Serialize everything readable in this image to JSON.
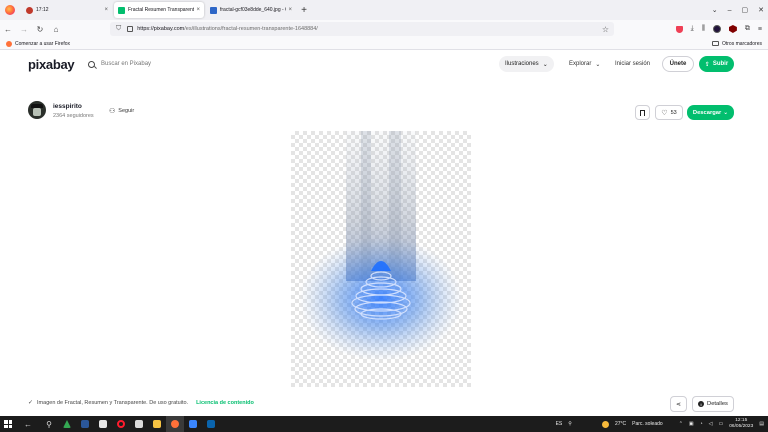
{
  "browser": {
    "tabs": [
      {
        "title": "17:12",
        "favicon_color": "#c0392b",
        "active": false
      },
      {
        "title": "Fractal Resumen Transparente",
        "favicon_color": "#02be6e",
        "active": true
      },
      {
        "title": "fractal-gcf03e8dde_640.jpg - Ci",
        "favicon_color": "#2d66c7",
        "active": false
      }
    ],
    "url_host": "https://pixabay.com",
    "url_path": "/es/illustrations/fractal-resumen-transparente-1648884/",
    "bookmark_left": "Comenzar a usar Firefox",
    "bookmark_right": "Otros marcadores"
  },
  "header": {
    "logo": "pixabay",
    "search_placeholder": "Buscar en Pixabay",
    "search_type": "Ilustraciones",
    "explore": "Explorar",
    "login": "Iniciar sesión",
    "join": "Únete",
    "upload": "Subir"
  },
  "author": {
    "name": "iesspirito",
    "followers": "2364 seguidores",
    "follow": "Seguir"
  },
  "actions": {
    "likes": "53",
    "download": "Descargar"
  },
  "caption": {
    "text": "Imagen de Fractal, Resumen y Transparente. De uso gratuito.",
    "license": "Licencia de contenido"
  },
  "footer_buttons": {
    "details": "Detalles"
  },
  "taskbar": {
    "lang": "ES",
    "temperature": "27°C",
    "weather": "Parc. soleado",
    "time": "12:15",
    "date": "06/05/2023"
  },
  "colors": {
    "brand_green": "#02be6e",
    "fractal_blue": "#1e6fff"
  }
}
